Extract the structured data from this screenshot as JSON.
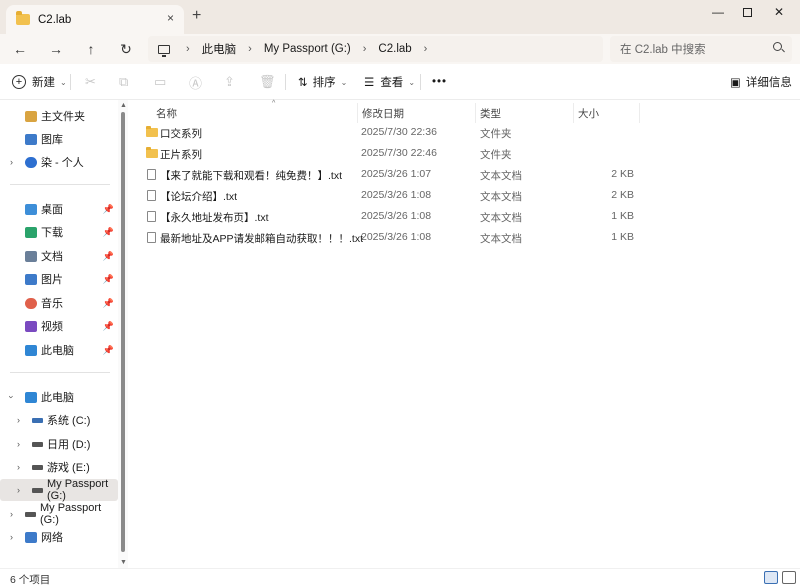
{
  "window": {
    "tab_title": "C2.lab",
    "tab_close": "×",
    "new_tab": "+",
    "minimize": "—",
    "close": "✕"
  },
  "nav": {
    "back": "←",
    "forward": "→",
    "up": "↑",
    "refresh": "↻"
  },
  "breadcrumb": {
    "items": [
      "此电脑",
      "My Passport (G:)",
      "C2.lab"
    ],
    "sep": "›"
  },
  "search": {
    "placeholder": "在 C2.lab 中搜索"
  },
  "toolbar": {
    "new_label": "新建",
    "sort_label": "排序",
    "view_label": "查看",
    "more_label": "•••",
    "details_label": "详细信息",
    "chev": "⌄"
  },
  "sidebar": {
    "top_items": [
      {
        "label": "主文件夹",
        "icon": "home-icon"
      },
      {
        "label": "图库",
        "icon": "gallery-icon"
      },
      {
        "label": "染 - 个人",
        "icon": "cloud-icon"
      }
    ],
    "quick_access": [
      {
        "label": "桌面",
        "icon": "desktop-icon"
      },
      {
        "label": "下载",
        "icon": "download-icon"
      },
      {
        "label": "文档",
        "icon": "documents-icon"
      },
      {
        "label": "图片",
        "icon": "pictures-icon"
      },
      {
        "label": "音乐",
        "icon": "music-icon"
      },
      {
        "label": "视频",
        "icon": "videos-icon"
      },
      {
        "label": "此电脑",
        "icon": "this-pc-icon"
      }
    ],
    "tree": [
      {
        "label": "此电脑",
        "icon": "this-pc-icon"
      },
      {
        "label": "系统 (C:)",
        "icon": "drive-icon"
      },
      {
        "label": "日用 (D:)",
        "icon": "drive-icon"
      },
      {
        "label": "游戏 (E:)",
        "icon": "drive-icon"
      },
      {
        "label": "My Passport (G:)",
        "icon": "drive-icon"
      },
      {
        "label": "My Passport (G:)",
        "icon": "drive-icon"
      },
      {
        "label": "网络",
        "icon": "network-icon"
      }
    ],
    "pin": "📌",
    "expand": "›"
  },
  "columns": {
    "name": "名称",
    "modified": "修改日期",
    "type": "类型",
    "size": "大小"
  },
  "files": [
    {
      "name": "口交系列",
      "modified": "2025/7/30 22:36",
      "type": "文件夹",
      "size": "",
      "kind": "folder"
    },
    {
      "name": "正片系列",
      "modified": "2025/7/30 22:46",
      "type": "文件夹",
      "size": "",
      "kind": "folder"
    },
    {
      "name": "【来了就能下载和观看！纯免费！】.txt",
      "modified": "2025/3/26 1:07",
      "type": "文本文档",
      "size": "2 KB",
      "kind": "txt"
    },
    {
      "name": "【论坛介绍】.txt",
      "modified": "2025/3/26 1:08",
      "type": "文本文档",
      "size": "2 KB",
      "kind": "txt"
    },
    {
      "name": "【永久地址发布页】.txt",
      "modified": "2025/3/26 1:08",
      "type": "文本文档",
      "size": "1 KB",
      "kind": "txt"
    },
    {
      "name": "最新地址及APP请发邮箱自动获取！！！.txt",
      "modified": "2025/3/26 1:08",
      "type": "文本文档",
      "size": "1 KB",
      "kind": "txt"
    }
  ],
  "status": {
    "count_text": "6 个项目"
  },
  "colors": {
    "titlebar": "#efe9e3",
    "folder": "#f2c14e",
    "accent": "#3a6fb3"
  }
}
